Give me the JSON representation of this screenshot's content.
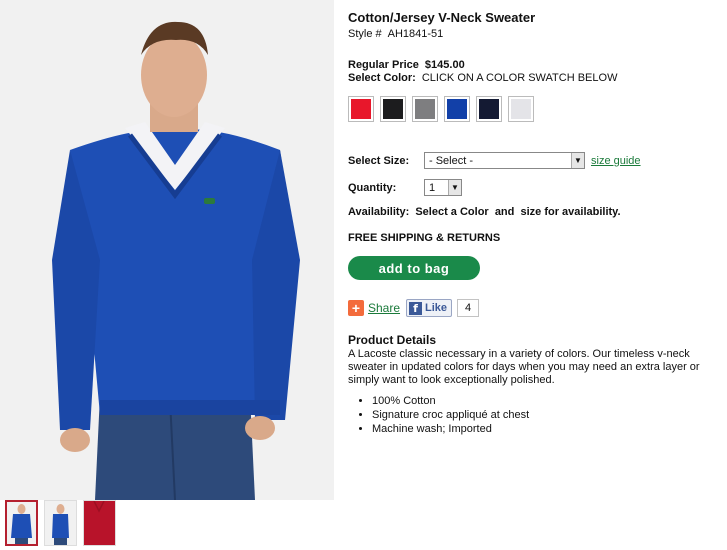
{
  "product": {
    "title": "Cotton/Jersey V-Neck Sweater",
    "style_label": "Style #",
    "style_number": "AH1841-51",
    "price_label": "Regular Price",
    "price": "$145.00",
    "color_label": "Select Color:",
    "color_hint": "CLICK ON A COLOR SWATCH BELOW",
    "swatches": [
      "#e8172b",
      "#1c1c1e",
      "#7e7e80",
      "#1240a8",
      "#141a33",
      "#e4e4e8"
    ]
  },
  "size": {
    "label": "Select Size:",
    "selected": "- Select -",
    "guide_link": "size guide"
  },
  "quantity": {
    "label": "Quantity:",
    "selected": "1"
  },
  "availability": {
    "label": "Availability:",
    "value": "Select a Color  and  size for availability."
  },
  "shipping": "FREE SHIPPING & RETURNS",
  "add_to_bag": "add to bag",
  "social": {
    "share": "Share",
    "like": "Like",
    "like_count": "4"
  },
  "details": {
    "title": "Product Details",
    "description": "A Lacoste classic necessary in a variety of colors. Our timeless v-neck sweater in updated colors for days when you may need an extra layer or simply want to look exceptionally polished.",
    "bullets": [
      "100% Cotton",
      "Signature croc appliqué at chest",
      "Machine wash; Imported"
    ]
  }
}
